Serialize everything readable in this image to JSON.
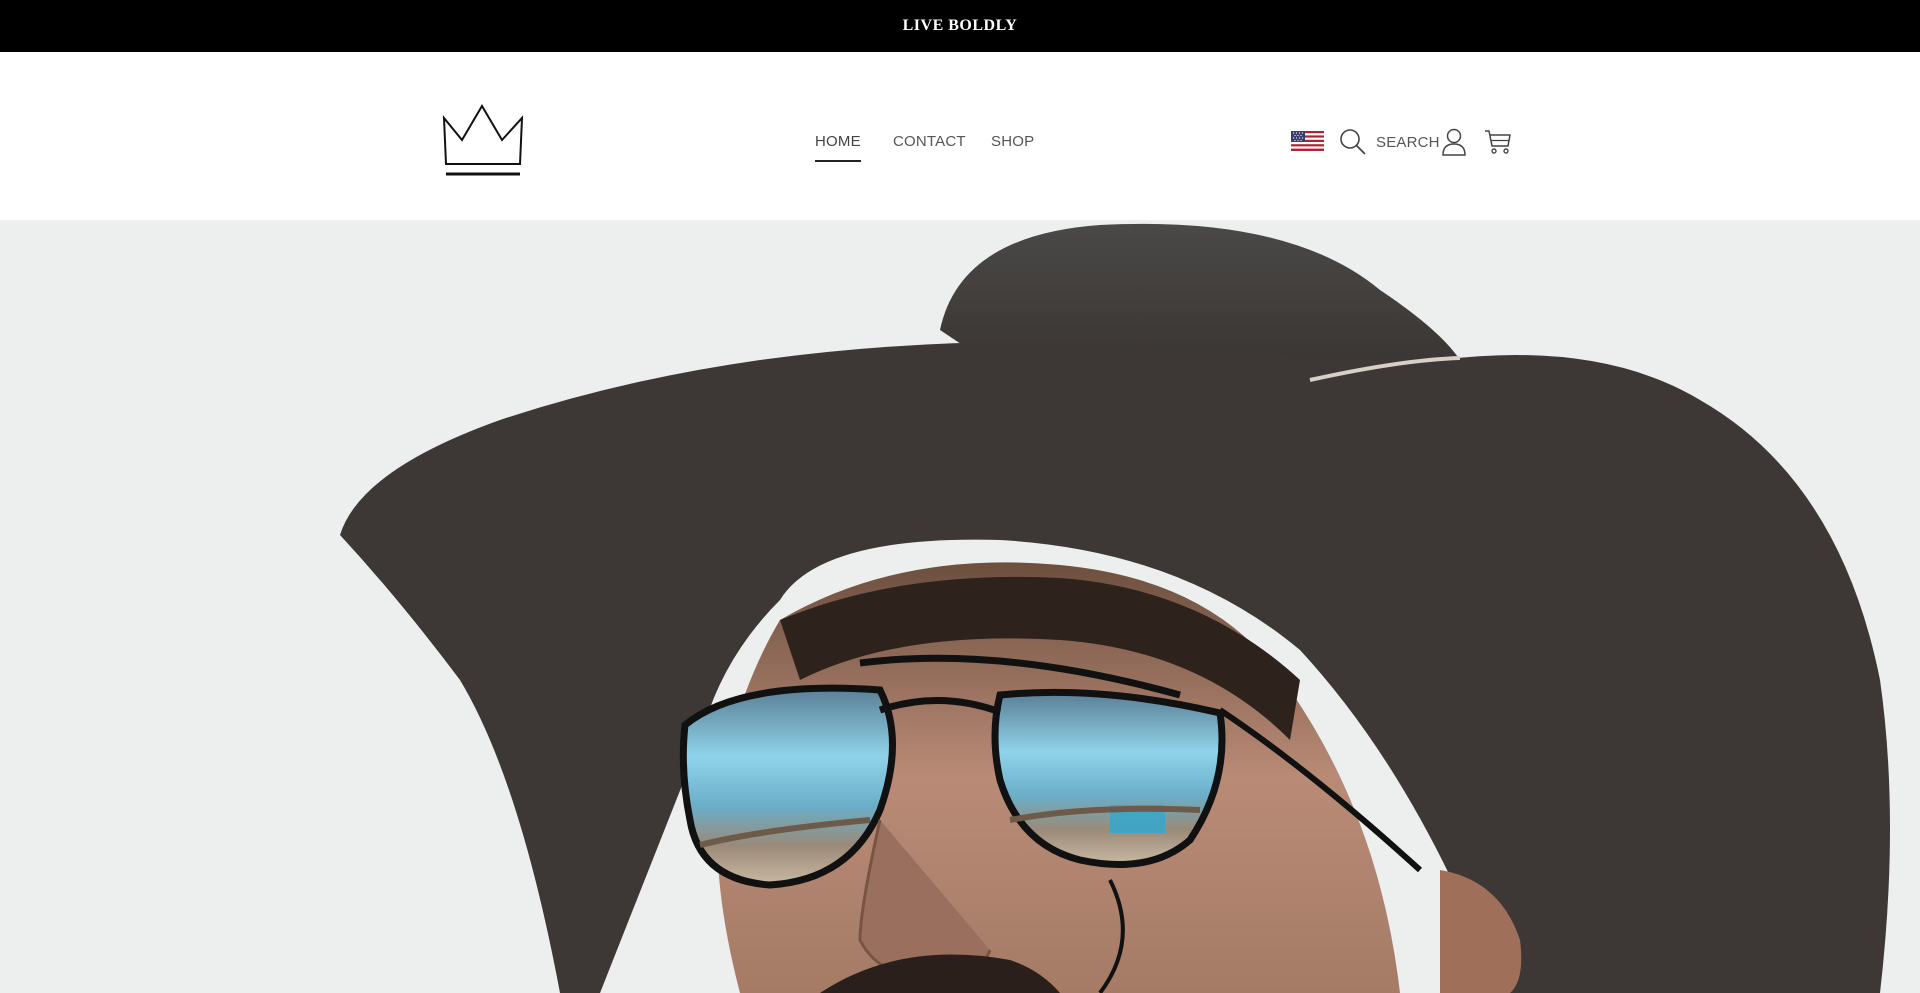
{
  "announcement": {
    "text": "LIVE BOLDLY"
  },
  "header": {
    "nav": [
      {
        "label": "HOME",
        "active": true
      },
      {
        "label": "CONTACT",
        "active": false
      },
      {
        "label": "SHOP",
        "active": false
      }
    ],
    "search_label": "SEARCH",
    "icons": {
      "logo": "crown-logo",
      "country": "us-flag-icon",
      "search": "search-icon",
      "account": "account-icon",
      "cart": "cart-icon"
    }
  },
  "hero": {
    "image": "man-in-cowboy-hat-and-mirrored-sunglasses",
    "background_color": "#ecefee"
  },
  "colors": {
    "announcement_bg": "#000000",
    "announcement_text": "#ffffff",
    "nav_text": "#555555",
    "active_underline": "#222222"
  }
}
